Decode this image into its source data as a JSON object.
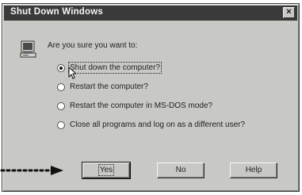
{
  "dialog": {
    "title": "Shut Down Windows",
    "close_label": "×",
    "question": "Are you sure you want to:",
    "options": [
      {
        "label": "Shut down the computer?",
        "selected": true
      },
      {
        "label": "Restart the computer?",
        "selected": false
      },
      {
        "label": "Restart the computer in MS-DOS mode?",
        "selected": false
      },
      {
        "label": "Close all programs and log on as a different user?",
        "selected": false
      }
    ],
    "buttons": {
      "yes": "Yes",
      "no": "No",
      "help": "Help"
    }
  },
  "colors": {
    "titlebar": "#3a3a3a",
    "dialog_face": "#c8c8c4"
  },
  "icons": [
    "computer-icon",
    "close-icon",
    "pointer-arrow-icon",
    "mouse-cursor-icon"
  ]
}
